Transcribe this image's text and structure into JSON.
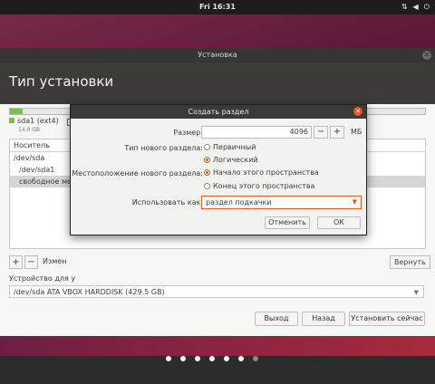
{
  "topbar": {
    "clock": "Fri 16:31",
    "tray_icons": [
      "network-icon",
      "volume-icon",
      "power-icon"
    ]
  },
  "window": {
    "title": "Установка",
    "heading": "Тип установки"
  },
  "disk_bar": {
    "used_fraction": 0.03,
    "partition_label": "sda1 (ext4)",
    "partition_size": "14.0 GB",
    "free_swatch": ""
  },
  "partition_table": {
    "column_header": "Носитель",
    "rows": [
      "/dev/sda",
      "/dev/sda1",
      "свободное мес"
    ]
  },
  "toolbar": {
    "add": "+",
    "remove": "−",
    "change": "Измен",
    "revert": "Вернуть"
  },
  "device": {
    "label": "Устройство для у",
    "value": "/dev/sda   ATA VBOX HARDDISK (429.5 GB)"
  },
  "footer_buttons": {
    "quit": "Выход",
    "back": "Назад",
    "install": "Установить сейчас"
  },
  "steps": {
    "total": 7,
    "current": 6
  },
  "dialog": {
    "title": "Создать раздел",
    "size_label": "Размер:",
    "size_value": "4096",
    "size_unit": "МБ",
    "minus": "−",
    "plus": "+",
    "type_label": "Тип нового раздела:",
    "type_primary": "Первичный",
    "type_logical": "Логический",
    "location_label": "Местоположение нового раздела:",
    "location_start": "Начало этого пространства",
    "location_end": "Конец этого пространства",
    "use_label": "Использовать как:",
    "use_value": "раздел подкачки",
    "cancel": "Отменить",
    "ok": "ОК"
  },
  "colors": {
    "accent": "#e95420",
    "progress": "#7cc242",
    "header": "#3c3b37"
  }
}
